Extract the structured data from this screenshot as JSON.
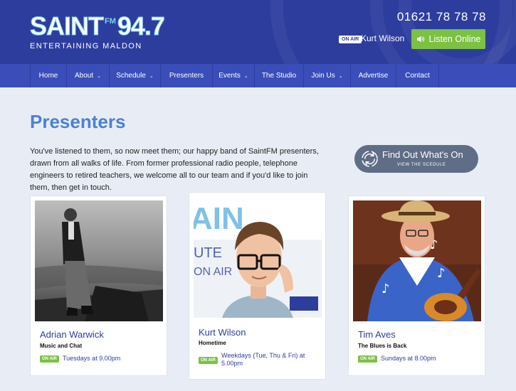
{
  "header": {
    "logo_saint": "SAINT",
    "logo_fm": "FM",
    "logo_freq": "94.7",
    "logo_tagline": "ENTERTAINING MALDON",
    "phone": "01621 78 78 78",
    "on_air_badge": "ON AIR",
    "on_air_presenter": "Kurt Wilson",
    "listen_label": "Listen Online",
    "listen_icon": "speaker-icon",
    "brand_color": "#2d3d9e",
    "accent_green": "#7bc143"
  },
  "nav": {
    "items": [
      {
        "label": "Home",
        "caret": ""
      },
      {
        "label": "About",
        "caret": "⌄"
      },
      {
        "label": "Schedule",
        "caret": "⌄"
      },
      {
        "label": "Presenters",
        "caret": ""
      },
      {
        "label": "Events",
        "caret": "⌄"
      },
      {
        "label": "The Studio",
        "caret": ""
      },
      {
        "label": "Join Us",
        "caret": "⌄"
      },
      {
        "label": "Advertise",
        "caret": ""
      },
      {
        "label": "Contact",
        "caret": ""
      }
    ]
  },
  "main": {
    "title": "Presenters",
    "intro": "You've listened to them, so now meet them; our happy band of SaintFM presenters, drawn from all walks of life. From former professional radio people, telephone engineers to retired teachers, we welcome all to our team and if you'd like to join them, then get in touch.",
    "find_out_title": "Find Out What's On",
    "find_out_sub": "VIEW THE SCEDULE",
    "find_out_icon": "refresh-icon"
  },
  "presenters": [
    {
      "name": "Adrian Warwick",
      "show": "Music and Chat",
      "badge": "ON AIR",
      "time": "Tuesdays at 9.00pm"
    },
    {
      "name": "Kurt Wilson",
      "show": "Hometime",
      "badge": "ON AIR",
      "time": "Weekdays (Tue, Thu & Fri) at 5.00pm"
    },
    {
      "name": "Tim Aves",
      "show": "The Blues is Back",
      "badge": "ON AIR",
      "time": "Sundays at 8.00pm"
    }
  ]
}
